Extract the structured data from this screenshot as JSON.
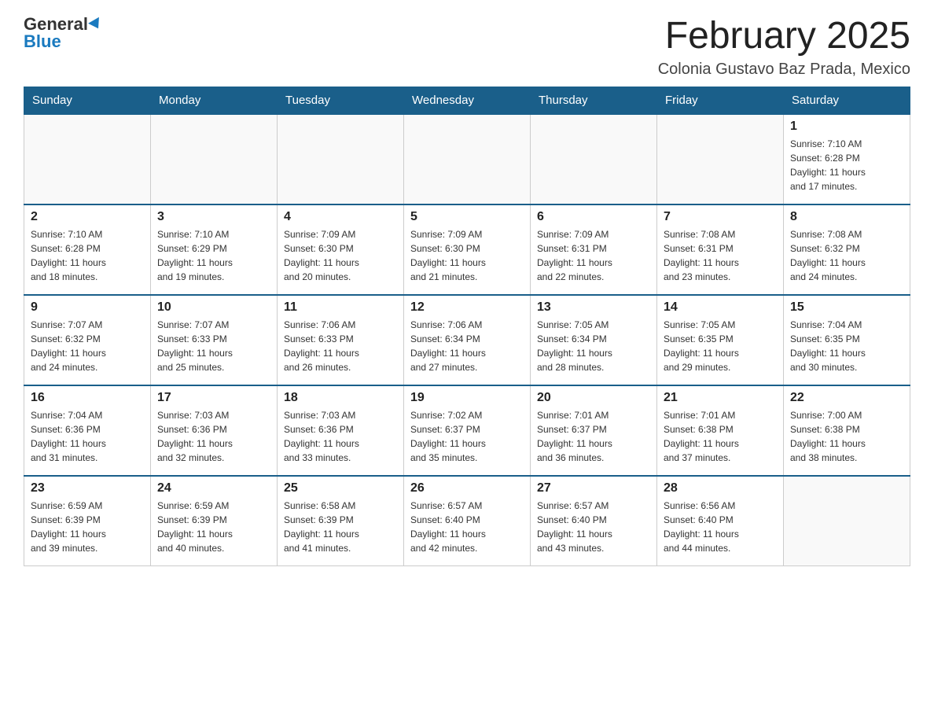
{
  "header": {
    "logo_general": "General",
    "logo_blue": "Blue",
    "month_title": "February 2025",
    "location": "Colonia Gustavo Baz Prada, Mexico"
  },
  "days_of_week": [
    "Sunday",
    "Monday",
    "Tuesday",
    "Wednesday",
    "Thursday",
    "Friday",
    "Saturday"
  ],
  "weeks": [
    [
      {
        "day": "",
        "info": ""
      },
      {
        "day": "",
        "info": ""
      },
      {
        "day": "",
        "info": ""
      },
      {
        "day": "",
        "info": ""
      },
      {
        "day": "",
        "info": ""
      },
      {
        "day": "",
        "info": ""
      },
      {
        "day": "1",
        "info": "Sunrise: 7:10 AM\nSunset: 6:28 PM\nDaylight: 11 hours\nand 17 minutes."
      }
    ],
    [
      {
        "day": "2",
        "info": "Sunrise: 7:10 AM\nSunset: 6:28 PM\nDaylight: 11 hours\nand 18 minutes."
      },
      {
        "day": "3",
        "info": "Sunrise: 7:10 AM\nSunset: 6:29 PM\nDaylight: 11 hours\nand 19 minutes."
      },
      {
        "day": "4",
        "info": "Sunrise: 7:09 AM\nSunset: 6:30 PM\nDaylight: 11 hours\nand 20 minutes."
      },
      {
        "day": "5",
        "info": "Sunrise: 7:09 AM\nSunset: 6:30 PM\nDaylight: 11 hours\nand 21 minutes."
      },
      {
        "day": "6",
        "info": "Sunrise: 7:09 AM\nSunset: 6:31 PM\nDaylight: 11 hours\nand 22 minutes."
      },
      {
        "day": "7",
        "info": "Sunrise: 7:08 AM\nSunset: 6:31 PM\nDaylight: 11 hours\nand 23 minutes."
      },
      {
        "day": "8",
        "info": "Sunrise: 7:08 AM\nSunset: 6:32 PM\nDaylight: 11 hours\nand 24 minutes."
      }
    ],
    [
      {
        "day": "9",
        "info": "Sunrise: 7:07 AM\nSunset: 6:32 PM\nDaylight: 11 hours\nand 24 minutes."
      },
      {
        "day": "10",
        "info": "Sunrise: 7:07 AM\nSunset: 6:33 PM\nDaylight: 11 hours\nand 25 minutes."
      },
      {
        "day": "11",
        "info": "Sunrise: 7:06 AM\nSunset: 6:33 PM\nDaylight: 11 hours\nand 26 minutes."
      },
      {
        "day": "12",
        "info": "Sunrise: 7:06 AM\nSunset: 6:34 PM\nDaylight: 11 hours\nand 27 minutes."
      },
      {
        "day": "13",
        "info": "Sunrise: 7:05 AM\nSunset: 6:34 PM\nDaylight: 11 hours\nand 28 minutes."
      },
      {
        "day": "14",
        "info": "Sunrise: 7:05 AM\nSunset: 6:35 PM\nDaylight: 11 hours\nand 29 minutes."
      },
      {
        "day": "15",
        "info": "Sunrise: 7:04 AM\nSunset: 6:35 PM\nDaylight: 11 hours\nand 30 minutes."
      }
    ],
    [
      {
        "day": "16",
        "info": "Sunrise: 7:04 AM\nSunset: 6:36 PM\nDaylight: 11 hours\nand 31 minutes."
      },
      {
        "day": "17",
        "info": "Sunrise: 7:03 AM\nSunset: 6:36 PM\nDaylight: 11 hours\nand 32 minutes."
      },
      {
        "day": "18",
        "info": "Sunrise: 7:03 AM\nSunset: 6:36 PM\nDaylight: 11 hours\nand 33 minutes."
      },
      {
        "day": "19",
        "info": "Sunrise: 7:02 AM\nSunset: 6:37 PM\nDaylight: 11 hours\nand 35 minutes."
      },
      {
        "day": "20",
        "info": "Sunrise: 7:01 AM\nSunset: 6:37 PM\nDaylight: 11 hours\nand 36 minutes."
      },
      {
        "day": "21",
        "info": "Sunrise: 7:01 AM\nSunset: 6:38 PM\nDaylight: 11 hours\nand 37 minutes."
      },
      {
        "day": "22",
        "info": "Sunrise: 7:00 AM\nSunset: 6:38 PM\nDaylight: 11 hours\nand 38 minutes."
      }
    ],
    [
      {
        "day": "23",
        "info": "Sunrise: 6:59 AM\nSunset: 6:39 PM\nDaylight: 11 hours\nand 39 minutes."
      },
      {
        "day": "24",
        "info": "Sunrise: 6:59 AM\nSunset: 6:39 PM\nDaylight: 11 hours\nand 40 minutes."
      },
      {
        "day": "25",
        "info": "Sunrise: 6:58 AM\nSunset: 6:39 PM\nDaylight: 11 hours\nand 41 minutes."
      },
      {
        "day": "26",
        "info": "Sunrise: 6:57 AM\nSunset: 6:40 PM\nDaylight: 11 hours\nand 42 minutes."
      },
      {
        "day": "27",
        "info": "Sunrise: 6:57 AM\nSunset: 6:40 PM\nDaylight: 11 hours\nand 43 minutes."
      },
      {
        "day": "28",
        "info": "Sunrise: 6:56 AM\nSunset: 6:40 PM\nDaylight: 11 hours\nand 44 minutes."
      },
      {
        "day": "",
        "info": ""
      }
    ]
  ]
}
